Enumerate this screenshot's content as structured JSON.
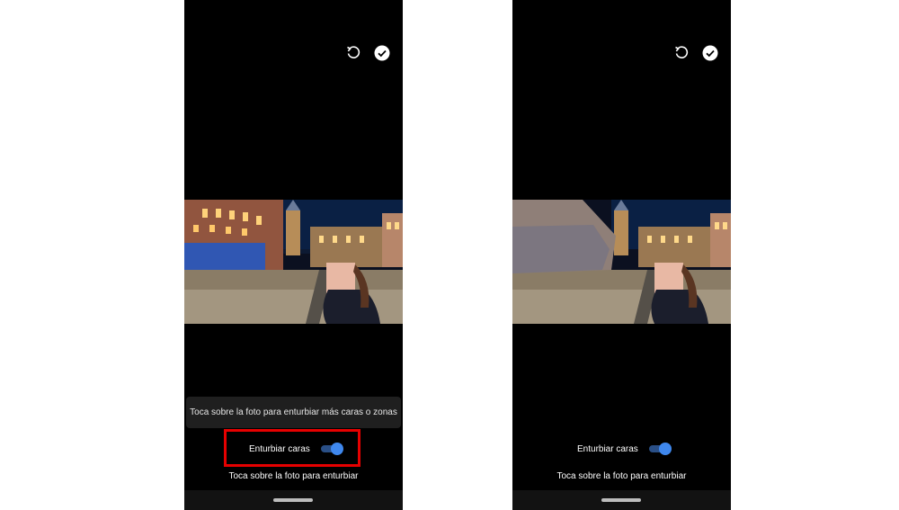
{
  "screens": {
    "left": {
      "top_actions": {
        "undo_icon": "undo-icon",
        "done_icon": "check-circle-icon"
      },
      "hint": "Toca sobre la foto para enturbiar más caras o zonas",
      "toggle": {
        "label": "Enturbiar caras",
        "state": "on"
      },
      "footer": "Toca sobre la foto para enturbiar",
      "highlighted": true
    },
    "right": {
      "top_actions": {
        "undo_icon": "undo-icon",
        "done_icon": "check-circle-icon"
      },
      "toggle": {
        "label": "Enturbiar caras",
        "state": "on"
      },
      "footer": "Toca sobre la foto para enturbiar"
    }
  },
  "colors": {
    "background": "#000000",
    "accent": "#3f88ee",
    "highlight": "#e60000"
  }
}
